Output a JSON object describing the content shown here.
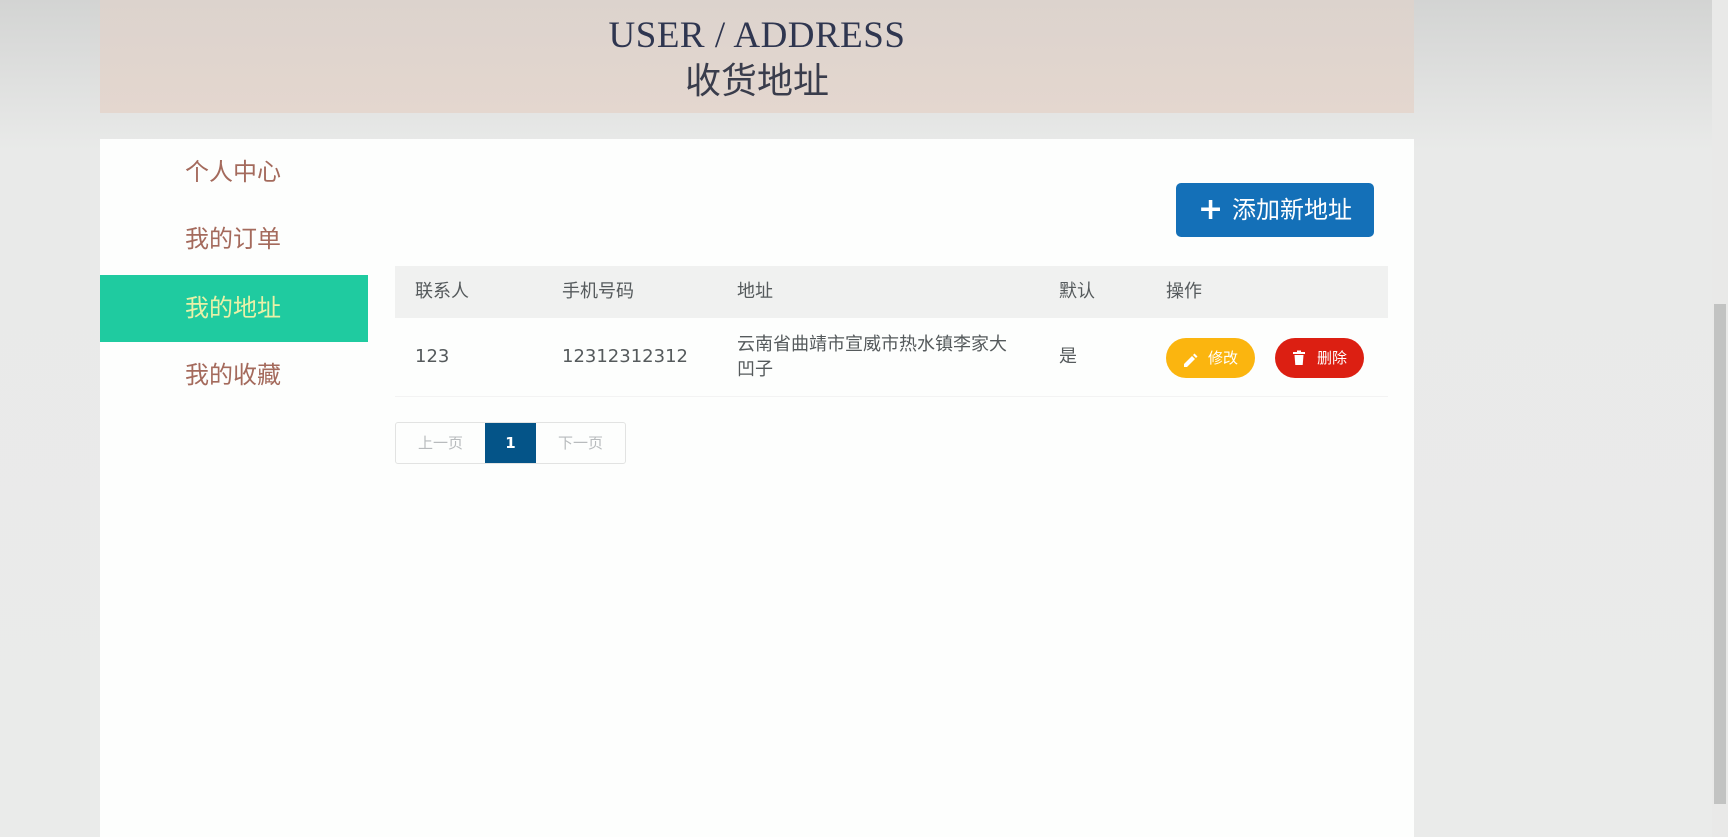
{
  "banner": {
    "title_en": "USER / ADDRESS",
    "title_cn": "收货地址"
  },
  "sidebar": {
    "items": [
      {
        "label": "个人中心",
        "active": false
      },
      {
        "label": "我的订单",
        "active": false
      },
      {
        "label": "我的地址",
        "active": true
      },
      {
        "label": "我的收藏",
        "active": false
      }
    ]
  },
  "toolbar": {
    "add_icon": "plus-icon",
    "add_label": "添加新地址"
  },
  "table": {
    "headers": [
      "联系人",
      "手机号码",
      "地址",
      "默认",
      "操作"
    ],
    "rows": [
      {
        "contact": "123",
        "phone": "12312312312",
        "address": "云南省曲靖市宣威市热水镇李家大凹子",
        "is_default": "是",
        "edit_label": "修改",
        "delete_label": "删除"
      }
    ]
  },
  "pagination": {
    "prev_label": "上一页",
    "current_page": "1",
    "next_label": "下一页"
  },
  "colors": {
    "accent_active": "#1fcba0",
    "primary_button": "#1470b8",
    "edit_button": "#fbb50f",
    "delete_button": "#dc1f12",
    "pager_current": "#045488"
  }
}
